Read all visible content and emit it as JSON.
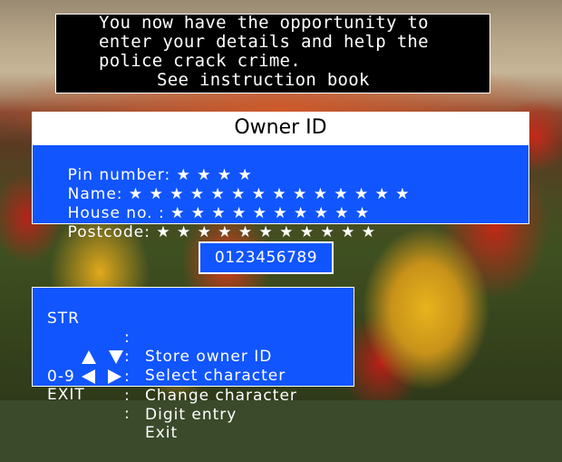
{
  "background": {
    "scene": "tulip-field"
  },
  "colors": {
    "panel_blue": "#1155ff",
    "info_bg": "#000000",
    "text": "#ffffff"
  },
  "info": {
    "lines": [
      "You now have the opportunity to",
      "enter your details and help the",
      "police crack crime.",
      "See instruction book"
    ]
  },
  "owner_id": {
    "title": "Owner ID"
  },
  "fields": [
    {
      "label": "Pin number:",
      "value": "★ ★ ★ ★"
    },
    {
      "label": "Name:",
      "value": "★ ★ ★ ★ ★ ★ ★ ★ ★ ★ ★ ★ ★ ★"
    },
    {
      "label": "House no. :",
      "value": "★ ★ ★ ★ ★ ★ ★ ★ ★ ★"
    },
    {
      "label": "Postcode:",
      "value": "★ ★ ★ ★ ★ ★ ★ ★ ★ ★ ★"
    }
  ],
  "digits": {
    "value": "0123456789"
  },
  "help": [
    {
      "key": "STR",
      "sep": ":",
      "desc": "Store owner ID"
    },
    {
      "key_icons": [
        "up-triangle-icon",
        "down-triangle-icon"
      ],
      "sep": ":",
      "desc": "Select character"
    },
    {
      "key_icons": [
        "left-triangle-icon",
        "right-triangle-icon"
      ],
      "sep": ":",
      "desc": "Change character"
    },
    {
      "key": "0-9",
      "sep": ":",
      "desc": "Digit entry"
    },
    {
      "key": "EXIT",
      "sep": ":",
      "desc": "Exit"
    }
  ]
}
